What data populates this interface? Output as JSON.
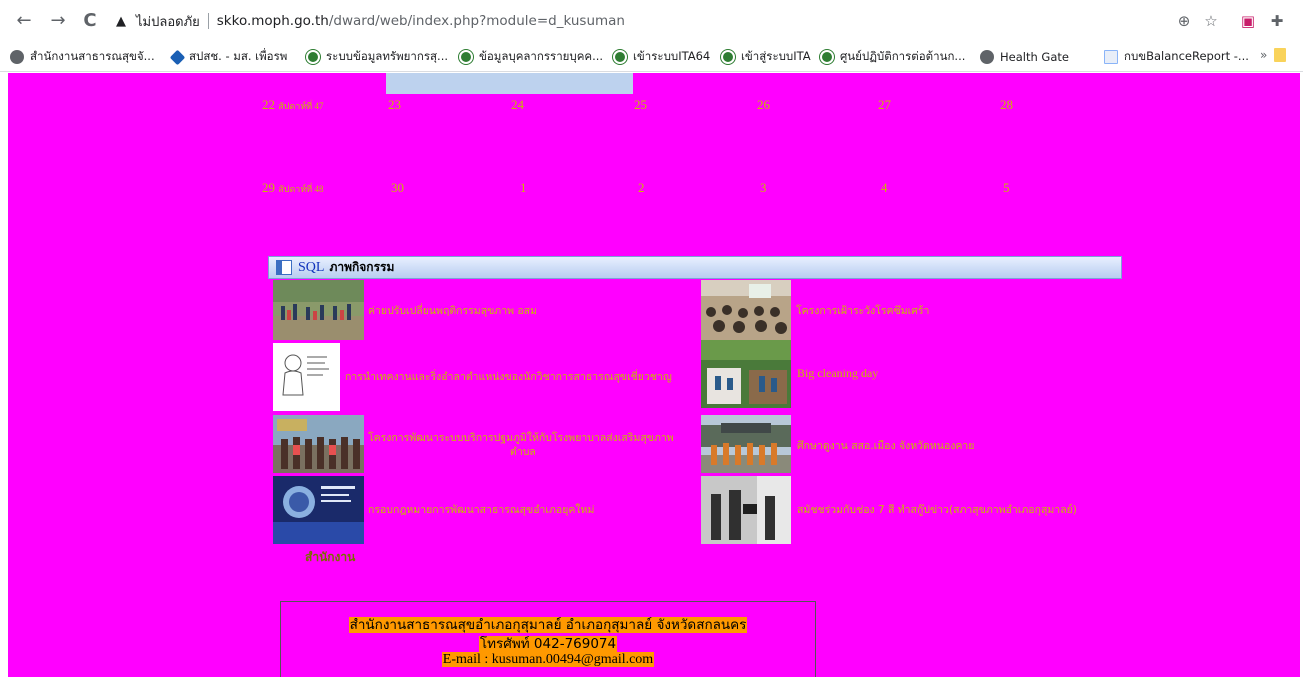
{
  "browser": {
    "nav": {
      "back": "←",
      "forward": "→",
      "reload": "C"
    },
    "security_label": "ไม่ปลอดภัย",
    "url_host": "skko.moph.go.th",
    "url_path": "/dward/web/index.php?module=d_kusuman",
    "icons": [
      "zoom-icon",
      "star-icon",
      "extension-badge-icon",
      "puzzle-icon"
    ],
    "bookmarks": [
      {
        "label": "สำนักงานสาธารณสุขจั...",
        "icon": "globe-icon"
      },
      {
        "label": "สปสช. - มส. เพื่อรพ",
        "icon": "nhso-icon"
      },
      {
        "label": "ระบบข้อมูลทรัพยากรสุ...",
        "icon": "moph-icon"
      },
      {
        "label": "ข้อมูลบุคลากรรายบุคค...",
        "icon": "moph-icon"
      },
      {
        "label": "เข้าระบบITA64",
        "icon": "moph-icon"
      },
      {
        "label": "เข้าสู่ระบบITA",
        "icon": "moph-icon"
      },
      {
        "label": "ศูนย์ปฏิบัติการต่อต้านก...",
        "icon": "moph-icon"
      },
      {
        "label": "Health Gate",
        "icon": "globe-icon"
      },
      {
        "label": "กบขBalanceReport -...",
        "icon": "doc-icon"
      }
    ],
    "more": "»"
  },
  "calendar": {
    "weeks": [
      {
        "days": [
          "22",
          "23",
          "24",
          "25",
          "26",
          "27",
          "28"
        ],
        "week_label": "สัปดาห์ที่ 47"
      },
      {
        "days": [
          "29",
          "30",
          "1",
          "2",
          "3",
          "4",
          "5"
        ],
        "week_label": "สัปดาห์ที่ 48"
      }
    ]
  },
  "activities": {
    "panel_sql": "SQL",
    "panel_title": "ภาพกิจกรรม",
    "items": [
      {
        "title": "ค่ายปรับเปลี่ยนพฤติกรรมสุขภาพ อสม",
        "thumb": "outdoor-crowd"
      },
      {
        "title": "โครงการเฝ้าระวังโรคซึมเศร้า",
        "thumb": "meeting-room"
      },
      {
        "title": "การนำเทคงานและริ่งอำลาตำแหน่งของนักวิชาการสาธารณสุขเชี่ยวชาญ",
        "thumb": "drawing"
      },
      {
        "title": "Big cleaning day",
        "thumb": "garden"
      },
      {
        "title": "โครงการพัฒนาระบบบริการปฐมภูมิให้กับโรงพยาบาลส่งเสริมสุขภาพ",
        "title_line2": "ตำบล",
        "thumb": "group-photo"
      },
      {
        "title": "ศึกษาดูงาน สสอ.เมือง จังหวัดหนองคาย",
        "thumb": "building-group"
      },
      {
        "title": "กรอบกฎหมายการพัฒนาสาธารณสุขอำเภอยุคใหม่",
        "thumb": "blue-slide"
      },
      {
        "title": "สมัชชร่วมกับช่อง 7 สี ทำสกู๊ปข่าว(สภาสุขภาพอำเภอกุสุมาลย์)",
        "thumb": "interview"
      }
    ],
    "office_label": "สำนักงาน"
  },
  "footer": {
    "line1": "สำนักงานสาธารณสุขอำเภอกุสุมาลย์ อำเภอกุสุมาลย์ จังหวัดสกลนคร",
    "line2": "โทรศัพท์ 042-769074",
    "line3": "E-mail : kusuman.00494@gmail.com"
  },
  "colors": {
    "page_bg": "#ff00ff",
    "link_text": "#c8b800",
    "footer_highlight": "#ff9900",
    "panel_header": "#b8cdf0"
  }
}
